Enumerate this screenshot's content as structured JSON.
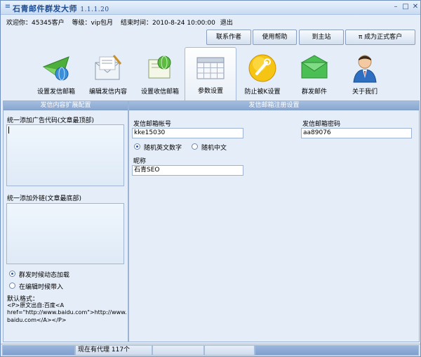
{
  "window": {
    "title": "石青邮件群发大师",
    "version": "1.1.1.20"
  },
  "info": {
    "welcome": "欢迎你：45345客户",
    "level": "等级：vip包月",
    "end_time": "结束时间：2010-8-24 10:00:00",
    "logout": "退出"
  },
  "top_buttons": {
    "contact_author": "联系作者",
    "help": "使用帮助",
    "home": "到主站",
    "become_customer": "π 成为正式客户"
  },
  "toolbar": {
    "items": [
      {
        "label": "设置发信邮箱",
        "icon": "send-mailbox-icon"
      },
      {
        "label": "编辑发信内容",
        "icon": "edit-letter-icon"
      },
      {
        "label": "设置收信邮箱",
        "icon": "receive-mailbox-icon"
      },
      {
        "label": "参数设置",
        "icon": "calendar-grid-icon"
      },
      {
        "label": "防止被K设置",
        "icon": "wrench-icon"
      },
      {
        "label": "群发邮件",
        "icon": "green-envelope-icon"
      },
      {
        "label": "关于我们",
        "icon": "user-icon"
      }
    ],
    "active_index": 3
  },
  "left_panel": {
    "header": "发信内容扩展配置",
    "ad_code_label": "统一添加广告代码(文章最顶部)",
    "ad_code_value": "",
    "external_link_label": "统一添加外链(文章最底部)",
    "external_link_value": "",
    "options": [
      {
        "label": "群发时候动态加载",
        "checked": true
      },
      {
        "label": "在编辑时候带入",
        "checked": false
      }
    ],
    "default_format_label": "默认格式：",
    "default_format_lines": [
      "<P>原文出自:百度<A",
      "href=\"http://www.baidu.com\">http://www.",
      "baidu.com</A></P>"
    ]
  },
  "right_panel": {
    "header": "发信邮箱注册设置",
    "account_label": "发信邮箱帐号",
    "account_value": "kke15030",
    "password_label": "发信邮箱密码",
    "password_value": "aa89076",
    "random_options": [
      {
        "label": "随机英文数字",
        "checked": true
      },
      {
        "label": "随机中文",
        "checked": false
      }
    ],
    "nickname_label": "昵称",
    "nickname_value": "石青SEO"
  },
  "statusbar": {
    "proxy_text": "现在有代理 117个"
  },
  "colors": {
    "title_text": "#1d4d92",
    "panel_header": "#8aa7d1",
    "window_bg": "#e4edf8"
  }
}
